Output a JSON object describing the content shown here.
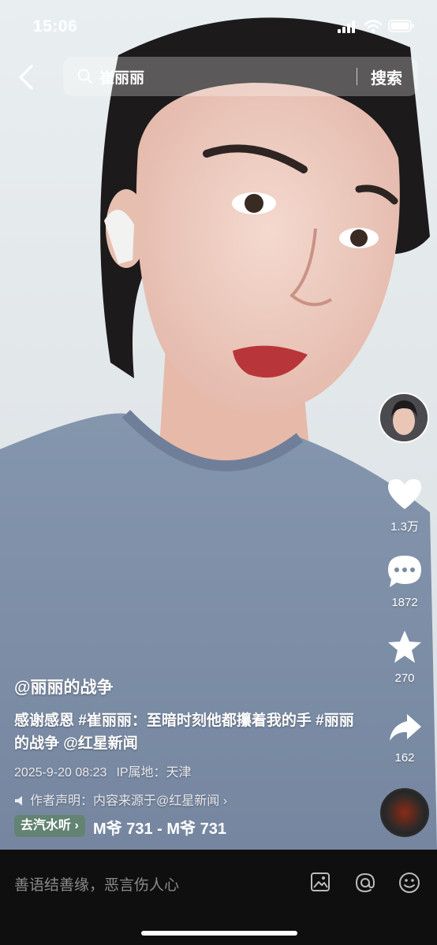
{
  "status_bar": {
    "time": "15:06"
  },
  "search": {
    "query": "崔丽丽",
    "button_label": "搜索"
  },
  "actions": {
    "like_count": "1.3万",
    "comment_count": "1872",
    "favorite_count": "270",
    "share_count": "162"
  },
  "caption": {
    "author": "@丽丽的战争",
    "description": "感谢感恩 #崔丽丽：至暗时刻他都攥着我的手 #丽丽的战争 @红星新闻",
    "date": "2025-9-20 08:23",
    "location": "IP属地：天津",
    "declaration": "作者声明：内容来源于@红星新闻"
  },
  "music": {
    "tag_label": "去汽水听",
    "track_text": "M爷    731 - M爷    731"
  },
  "comment_bar": {
    "placeholder": "善语结善缘，恶言伤人心"
  },
  "icons": [
    "back-chevron-icon",
    "search-icon",
    "heart-icon",
    "comment-icon",
    "star-icon",
    "share-icon",
    "image-icon",
    "mention-icon",
    "emoji-icon",
    "speaker-icon",
    "signal-icon",
    "wifi-icon",
    "battery-icon"
  ],
  "colors": {
    "background": "#000000",
    "input_bar": "#0f0f0f",
    "music_tag": "#5c8264"
  }
}
